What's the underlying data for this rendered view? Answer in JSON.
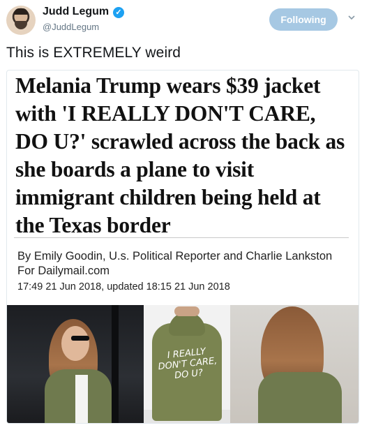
{
  "tweet": {
    "author": {
      "display_name": "Judd Legum",
      "handle": "@JuddLegum",
      "verified_glyph": "✓"
    },
    "follow_button": {
      "label": "Following"
    },
    "text": "This is EXTREMELY weird"
  },
  "card": {
    "headline": "Melania Trump wears $39 jacket with 'I REALLY DON'T CARE, DO U?' scrawled across the back as she boards a plane to visit immigrant children being held at the Texas border",
    "byline": "By Emily Goodin, U.s. Political Reporter and Charlie Lankston For Dailymail.com",
    "timestamp": "17:49 21 Jun 2018, updated 18:15 21 Jun 2018",
    "jacket_text": "I REALLY DON'T CARE, DO U?"
  },
  "colors": {
    "follow_button_bg": "#a6c8e3",
    "verified_blue": "#1da1f2",
    "jacket_green": "#6f7a4e"
  },
  "icons": {
    "verified": "verified-badge-icon",
    "more": "chevron-down-icon"
  }
}
